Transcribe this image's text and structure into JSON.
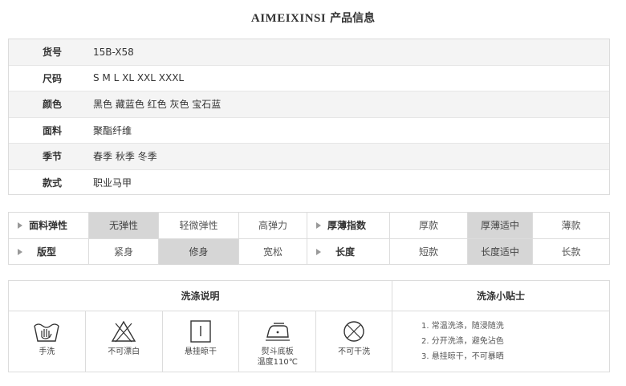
{
  "title": {
    "brand": "AIMEIXINSI",
    "suffix": " 产品信息"
  },
  "info": [
    {
      "key": "货号",
      "value": "15B-X58"
    },
    {
      "key": "尺码",
      "value": "S M L XL XXL XXXL"
    },
    {
      "key": "颜色",
      "value": "黑色 藏蓝色 红色 灰色 宝石蓝"
    },
    {
      "key": "面料",
      "value": "聚酯纤维"
    },
    {
      "key": "季节",
      "value": "春季 秋季 冬季"
    },
    {
      "key": "款式",
      "value": "职业马甲"
    }
  ],
  "attrs": {
    "row1": {
      "label1": "面料弹性",
      "opts1": [
        "无弹性",
        "轻微弹性",
        "高弹力"
      ],
      "sel1": 0,
      "label2": "厚薄指数",
      "opts2": [
        "厚款",
        "厚薄适中",
        "薄款"
      ],
      "sel2": 1
    },
    "row2": {
      "label1": "版型",
      "opts1": [
        "紧身",
        "修身",
        "宽松"
      ],
      "sel1": 1,
      "label2": "长度",
      "opts2": [
        "短款",
        "长度适中",
        "长款"
      ],
      "sel2": 1
    }
  },
  "wash": {
    "header_left": "洗涤说明",
    "header_right": "洗涤小贴士",
    "icons": [
      {
        "icon": "hand-wash-icon",
        "label": "手洗"
      },
      {
        "icon": "no-bleach-icon",
        "label": "不可漂白"
      },
      {
        "icon": "hang-dry-icon",
        "label": "悬挂晾干"
      },
      {
        "icon": "iron-icon",
        "label": "熨斗底板",
        "label2": "温度110℃"
      },
      {
        "icon": "no-dry-clean-icon",
        "label": "不可干洗"
      }
    ],
    "tips": [
      "1. 常温洗涤，随浸随洗",
      "2. 分开洗涤，避免沾色",
      "3. 悬挂晾干，不可暴晒"
    ]
  },
  "colors": {
    "border": "#dcdcdc",
    "alt_row": "#f4f4f4",
    "selected": "#d6d6d6"
  }
}
